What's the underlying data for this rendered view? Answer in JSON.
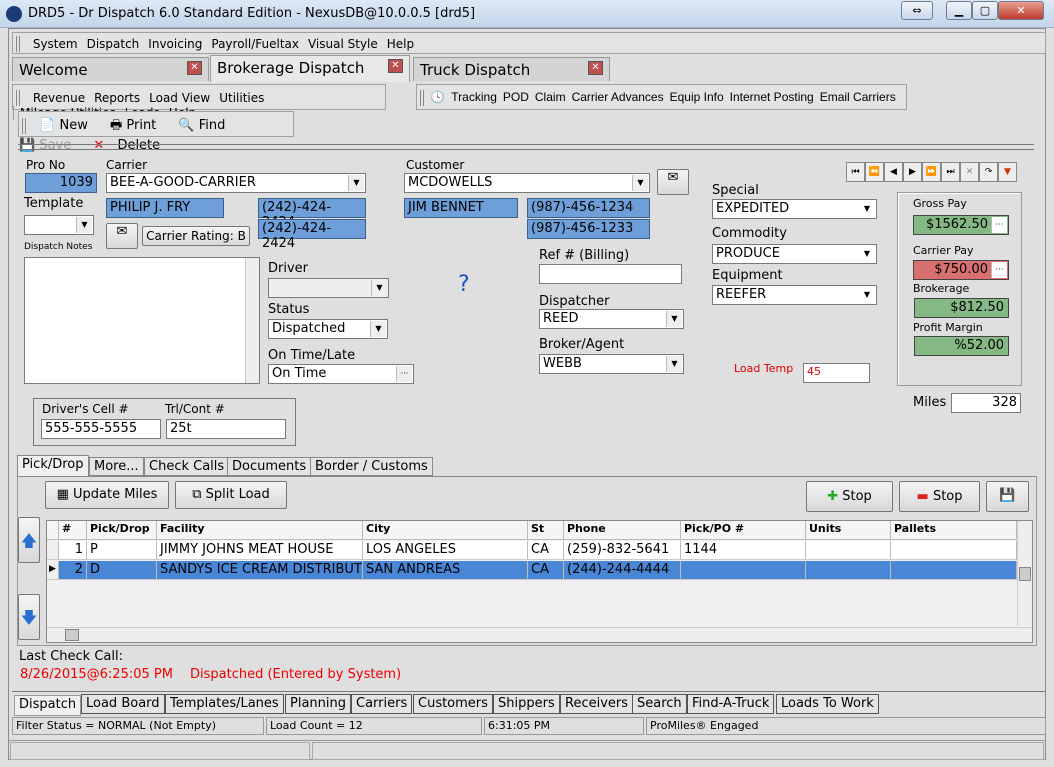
{
  "window": {
    "title": "DRD5 - Dr Dispatch 6.0 Standard Edition - NexusDB@10.0.0.5 [drd5]"
  },
  "menu": [
    "System",
    "Dispatch",
    "Invoicing",
    "Payroll/Fueltax",
    "Visual Style",
    "Help"
  ],
  "tabs": [
    "Welcome",
    "Brokerage Dispatch",
    "Truck Dispatch"
  ],
  "toolbar1": [
    "Revenue",
    "Reports",
    "Load View",
    "Utilities",
    "Mileage Utilities",
    "Loads",
    "Help"
  ],
  "toolbar_right": [
    "Tracking",
    "POD",
    "Claim",
    "Carrier Advances",
    "Equip Info",
    "Internet Posting",
    "Email Carriers"
  ],
  "toolbar2": {
    "new": "New",
    "print": "Print",
    "find": "Find",
    "save": "Save",
    "delete": "Delete"
  },
  "form": {
    "pro_no_label": "Pro No",
    "pro_no": "1039",
    "carrier_label": "Carrier",
    "carrier": "BEE-A-GOOD-CARRIER",
    "carrier_contact": "PHILIP J. FRY",
    "carrier_phone1": "(242)-424-2424",
    "carrier_phone2": "(242)-424-2424",
    "template_label": "Template",
    "dispatch_notes_label": "Dispatch Notes",
    "carrier_rating": "Carrier Rating: B",
    "customer_label": "Customer",
    "customer": "MCDOWELLS",
    "customer_contact": "JIM BENNET",
    "customer_phone1": "(987)-456-1234",
    "customer_phone2": "(987)-456-1233",
    "driver_label": "Driver",
    "driver": "",
    "status_label": "Status",
    "status": "Dispatched",
    "ontime_label": "On Time/Late",
    "ontime": "On Time",
    "question": "?",
    "ref_label": "Ref # (Billing)",
    "ref": "",
    "dispatcher_label": "Dispatcher",
    "dispatcher": "REED",
    "broker_label": "Broker/Agent",
    "broker": "WEBB",
    "special_label": "Special",
    "special": "EXPEDITED",
    "commodity_label": "Commodity",
    "commodity": "PRODUCE",
    "equipment_label": "Equipment",
    "equipment": "REEFER",
    "load_temp_label": "Load Temp",
    "load_temp": "45",
    "gross_label": "Gross Pay",
    "gross": "$1562.50",
    "carrier_pay_label": "Carrier Pay",
    "carrier_pay": "$750.00",
    "brokerage_label": "Brokerage",
    "brokerage": "$812.50",
    "margin_label": "Profit Margin",
    "margin": "%52.00",
    "miles_label": "Miles",
    "miles": "328",
    "cell_label": "Driver's Cell #",
    "cell": "555-555-5555",
    "trl_label": "Trl/Cont #",
    "trl": "25t"
  },
  "subtabs": [
    "Pick/Drop",
    "More...",
    "Check Calls",
    "Documents",
    "Border / Customs"
  ],
  "actions": {
    "update_miles": "Update Miles",
    "split_load": "Split Load",
    "add_stop": "Stop",
    "remove_stop": "Stop"
  },
  "grid": {
    "columns": [
      "#",
      "Pick/Drop",
      "Facility",
      "City",
      "St",
      "Phone",
      "Pick/PO #",
      "Units",
      "Pallets"
    ],
    "rows": [
      [
        "1",
        "P",
        "JIMMY JOHNS MEAT HOUSE",
        "LOS ANGELES",
        "CA",
        "(259)-832-5641",
        "1144",
        "",
        ""
      ],
      [
        "2",
        "D",
        "SANDYS ICE CREAM DISTRIBUTOR",
        "SAN ANDREAS",
        "CA",
        "(244)-244-4444",
        "",
        "",
        ""
      ]
    ]
  },
  "check_call": {
    "label": "Last Check Call:",
    "time": "8/26/2015@6:25:05 PM",
    "text": "Dispatched (Entered by System)"
  },
  "bottom_tabs": [
    "Dispatch",
    "Load Board",
    "Templates/Lanes",
    "Planning",
    "Carriers",
    "Customers",
    "Shippers",
    "Receivers",
    "Search",
    "Find-A-Truck",
    "Loads To Work"
  ],
  "status": [
    "Filter Status = NORMAL (Not Empty)",
    "Load Count = 12",
    "6:31:05 PM",
    "ProMiles® Engaged"
  ]
}
